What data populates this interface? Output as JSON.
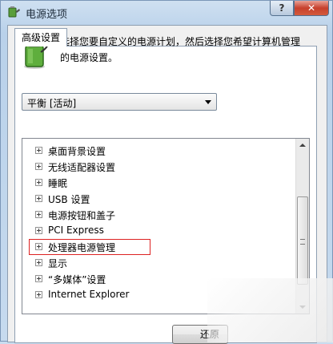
{
  "window": {
    "title": "电源选项",
    "help_glyph": "?",
    "close_glyph": "✕"
  },
  "tabs": [
    {
      "label": "高级设置"
    }
  ],
  "panel": {
    "description": "选择您要自定义的电源计划，然后选择您希望计算机管理的电源设置。",
    "plan_select": {
      "value": "平衡 [活动]"
    },
    "tree_items": [
      {
        "label": "桌面背景设置"
      },
      {
        "label": "无线适配器设置"
      },
      {
        "label": "睡眠"
      },
      {
        "label": "USB 设置"
      },
      {
        "label": "电源按钮和盖子"
      },
      {
        "label": "PCI Express"
      },
      {
        "label": "处理器电源管理",
        "highlighted": true
      },
      {
        "label": "显示"
      },
      {
        "label": "“多媒体”设置"
      },
      {
        "label": "Internet Explorer"
      }
    ]
  },
  "buttons": {
    "restore_label": "还原"
  },
  "colors": {
    "highlight_border": "#dd2222",
    "close_button": "#c7402c"
  },
  "icons": {
    "app": "battery-plug-icon",
    "description": "battery-plug-icon"
  }
}
